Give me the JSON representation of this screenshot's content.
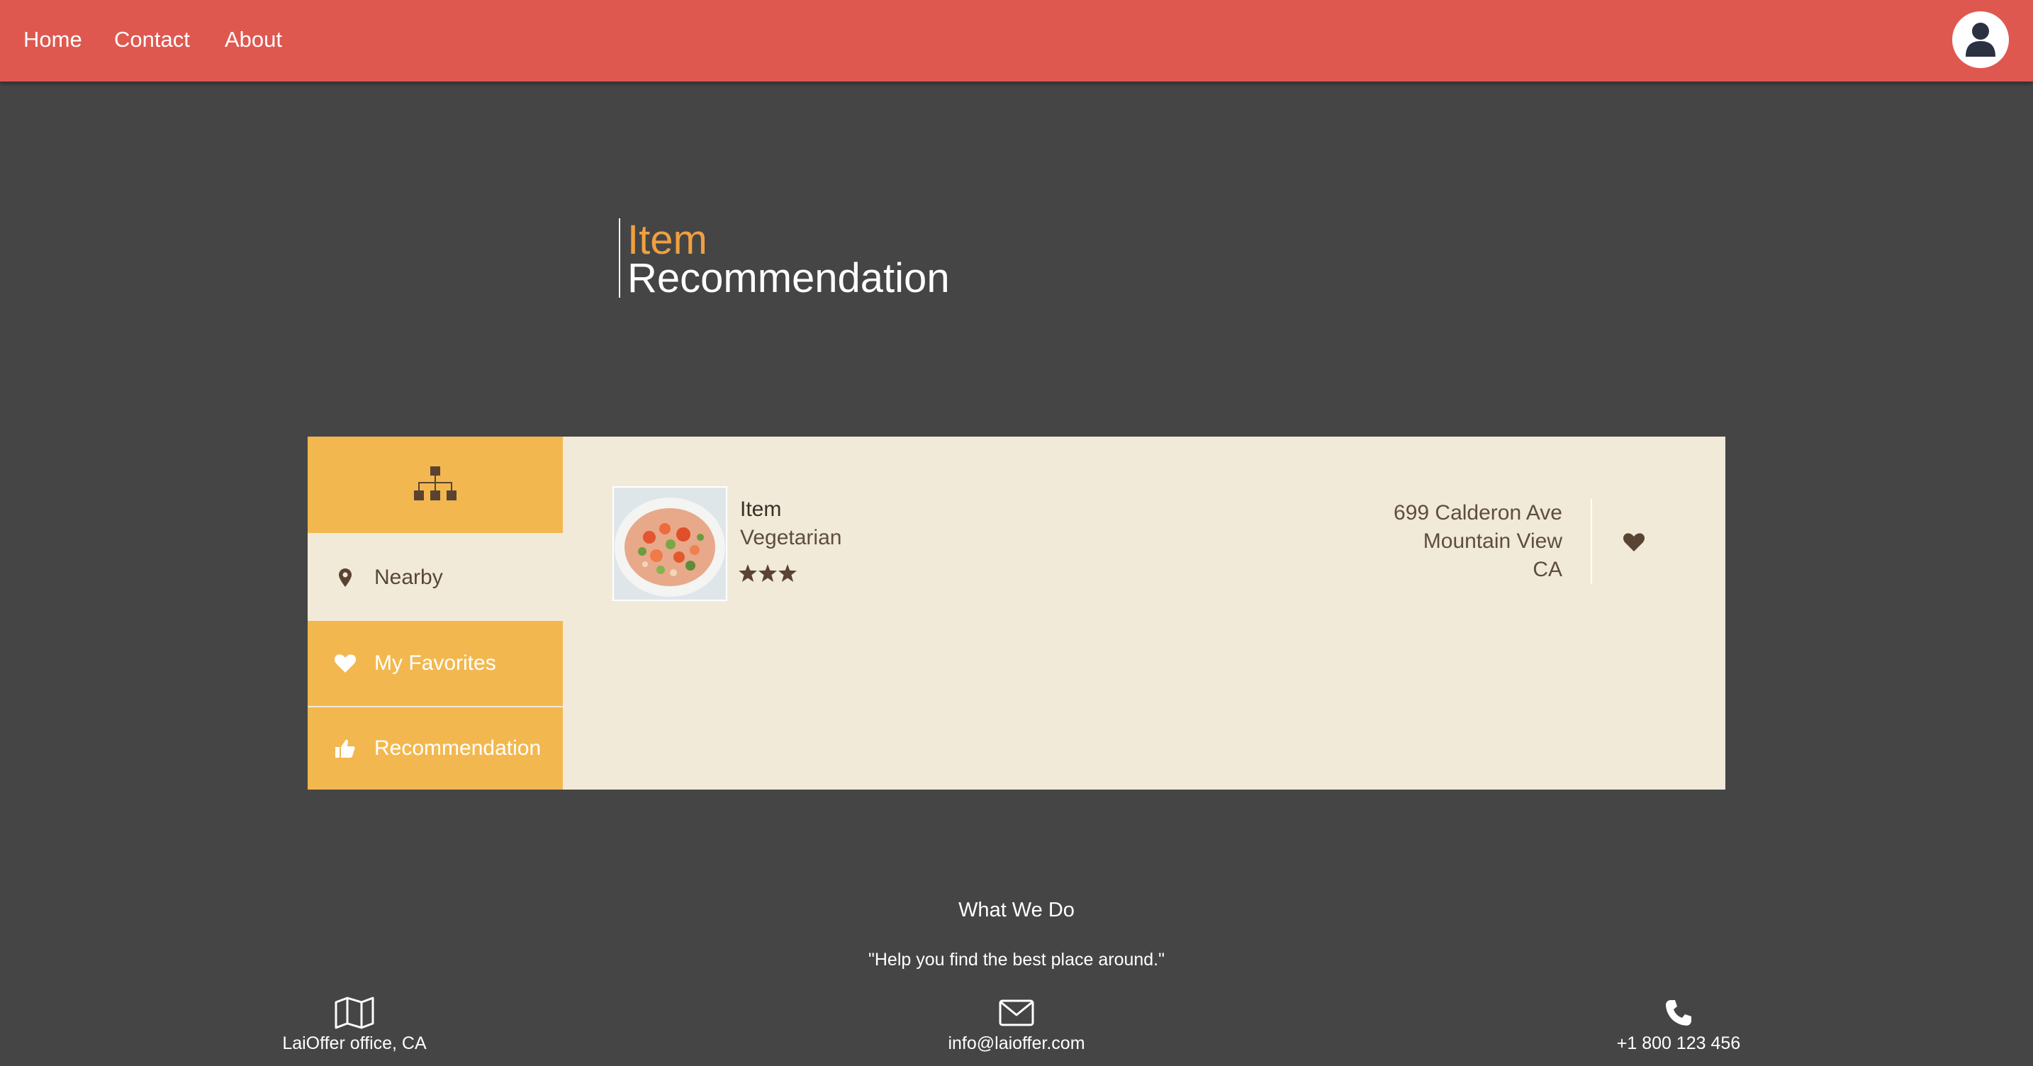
{
  "nav": {
    "home": "Home",
    "contact": "Contact",
    "about": "About"
  },
  "header": {
    "avatar_icon": "user-icon"
  },
  "title": {
    "line1": "Item",
    "line2": "Recommendation"
  },
  "sidebar": {
    "logo_icon": "sitemap-icon",
    "items": [
      {
        "label": "Nearby",
        "icon": "map-marker-icon"
      },
      {
        "label": "My Favorites",
        "icon": "heart-icon"
      },
      {
        "label": "Recommendation",
        "icon": "thumbs-up-icon"
      }
    ]
  },
  "item": {
    "name": "Item",
    "category": "Vegetarian",
    "rating": 3,
    "address": [
      "699 Calderon Ave",
      "Mountain View",
      "CA"
    ],
    "favorite_icon": "heart-icon"
  },
  "footer": {
    "heading": "What We Do",
    "quote": "\"Help you find the best place around.\"",
    "office": "LaiOffer office, CA",
    "email": "info@laioffer.com",
    "phone": "+1 800 123 456"
  },
  "colors": {
    "header": "#df5850",
    "background": "#454545",
    "accent": "#f2b84f",
    "panel": "#f1ead9",
    "title_highlight": "#f0a040",
    "text_brown": "#5e4d40"
  }
}
